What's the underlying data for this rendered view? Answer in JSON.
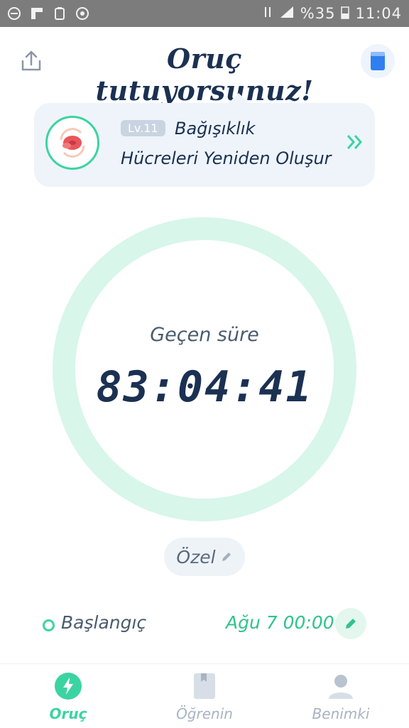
{
  "status_bar": {
    "icons": [
      "minus-circle-icon",
      "flipboard-icon",
      "recycle-icon",
      "whatsapp-icon"
    ],
    "battery": "%35",
    "time": "11:04"
  },
  "header": {
    "title": "Oruç tutuyorsunuz!"
  },
  "stage": {
    "level": "Lv.11",
    "line1": "Bağışıklık",
    "line2": "Hücreleri Yeniden Oluşur"
  },
  "timer": {
    "label": "Geçen süre",
    "value": "83:04:41"
  },
  "plan": {
    "label": "Özel"
  },
  "start": {
    "label": "Başlangıç",
    "time": "Ağu 7 00:00"
  },
  "nav": {
    "items": [
      {
        "label": "Oruç",
        "icon": "lightning-icon",
        "active": true
      },
      {
        "label": "Öğrenin",
        "icon": "book-icon",
        "active": false
      },
      {
        "label": "Benimki",
        "icon": "person-icon",
        "active": false
      }
    ]
  },
  "colors": {
    "accent": "#3bd4a0",
    "title": "#1b3152",
    "ring": "#d8f6ea"
  }
}
